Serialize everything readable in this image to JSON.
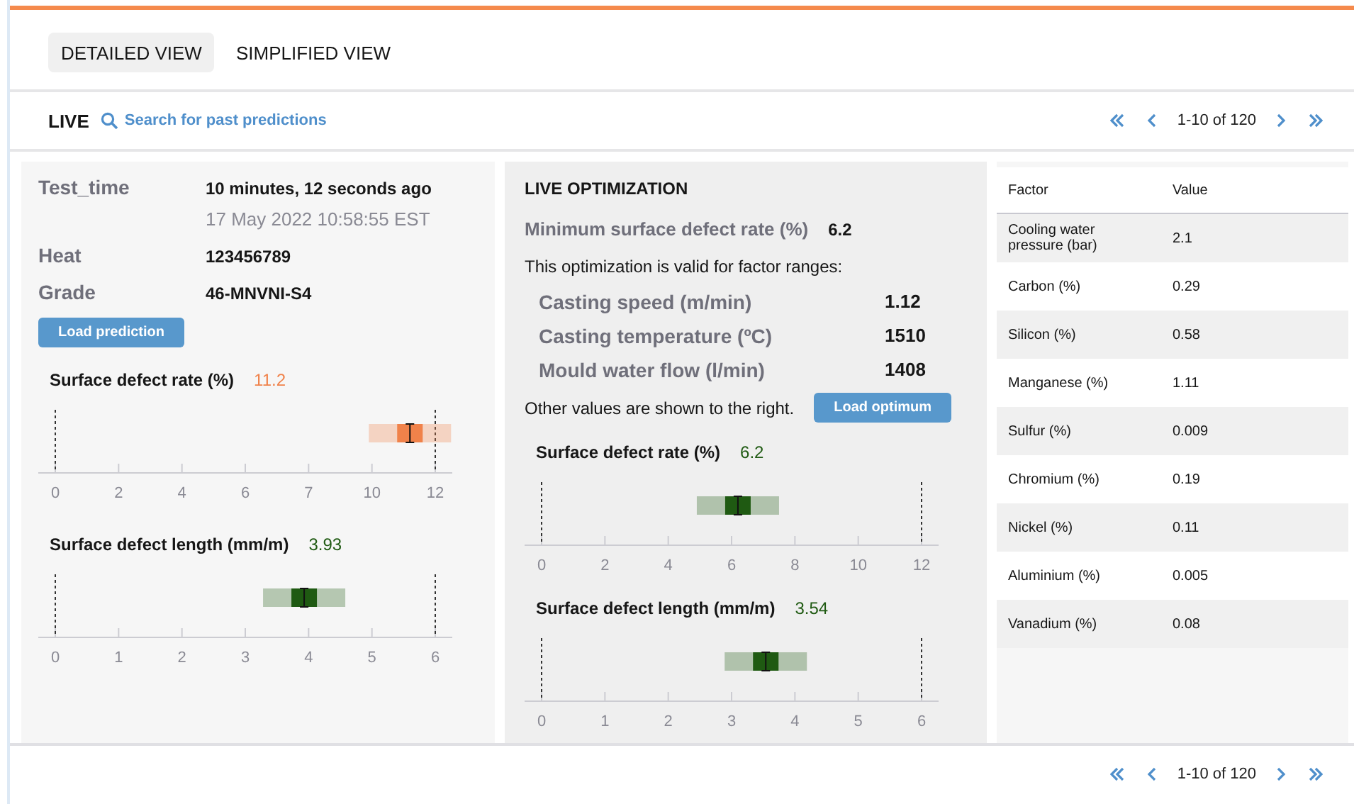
{
  "tabs": [
    {
      "label": "DETAILED VIEW",
      "selected": true
    },
    {
      "label": "SIMPLIFIED VIEW",
      "selected": false
    }
  ],
  "toolbar": {
    "live_label": "LIVE",
    "search_link": "Search for past predictions",
    "pagination": "1-10 of 120"
  },
  "prediction": {
    "fields": [
      {
        "label": "Test_time",
        "value": "10 minutes, 12 seconds ago",
        "subvalue": "17 May 2022 10:58:55 EST"
      },
      {
        "label": "Heat",
        "value": "123456789"
      },
      {
        "label": "Grade",
        "value": "46-MNVNI-S4"
      }
    ],
    "button": "Load prediction",
    "charts": [
      {
        "title": "Surface defect rate (%)",
        "value": "11.2",
        "color": "#f0824a",
        "ticks": [
          "0",
          "2",
          "4",
          "6",
          "7",
          "10",
          "12"
        ]
      },
      {
        "title": "Surface defect length (mm/m)",
        "value": "3.93",
        "color": "#1f5a12",
        "ticks": [
          "0",
          "1",
          "2",
          "3",
          "4",
          "5",
          "6"
        ]
      }
    ]
  },
  "optimization": {
    "title": "LIVE OPTIMIZATION",
    "minimum": {
      "label": "Minimum surface defect rate (%)",
      "value": "6.2"
    },
    "note": "This optimization is valid for factor ranges:",
    "ranges": [
      {
        "label": "Casting speed (m/min)",
        "value": "1.12"
      },
      {
        "label": "Casting temperature (ºC)",
        "value": "1510"
      },
      {
        "label": "Mould water flow (l/min)",
        "value": "1408"
      }
    ],
    "other_note": "Other values are shown to the right.",
    "button": "Load optimum",
    "charts": [
      {
        "title": "Surface defect rate (%)",
        "value": "6.2",
        "color": "#1f5a12",
        "ticks": [
          "0",
          "2",
          "4",
          "6",
          "8",
          "10",
          "12"
        ]
      },
      {
        "title": "Surface defect length (mm/m)",
        "value": "3.54",
        "color": "#1f5a12",
        "ticks": [
          "0",
          "1",
          "2",
          "3",
          "4",
          "5",
          "6"
        ]
      }
    ]
  },
  "factor_table": {
    "columns": [
      "Factor",
      "Value"
    ],
    "rows": [
      [
        "Cooling water pressure (bar)",
        "2.1"
      ],
      [
        "Carbon (%)",
        "0.29"
      ],
      [
        "Silicon (%)",
        "0.58"
      ],
      [
        "Manganese (%)",
        "1.11"
      ],
      [
        "Sulfur (%)",
        "0.009"
      ],
      [
        "Chromium (%)",
        "0.19"
      ],
      [
        "Nickel (%)",
        "0.11"
      ],
      [
        "Aluminium (%)",
        "0.005"
      ],
      [
        "Vanadium (%)",
        "0.08"
      ]
    ]
  },
  "footer": {
    "pagination": "1-10 of 120"
  }
}
